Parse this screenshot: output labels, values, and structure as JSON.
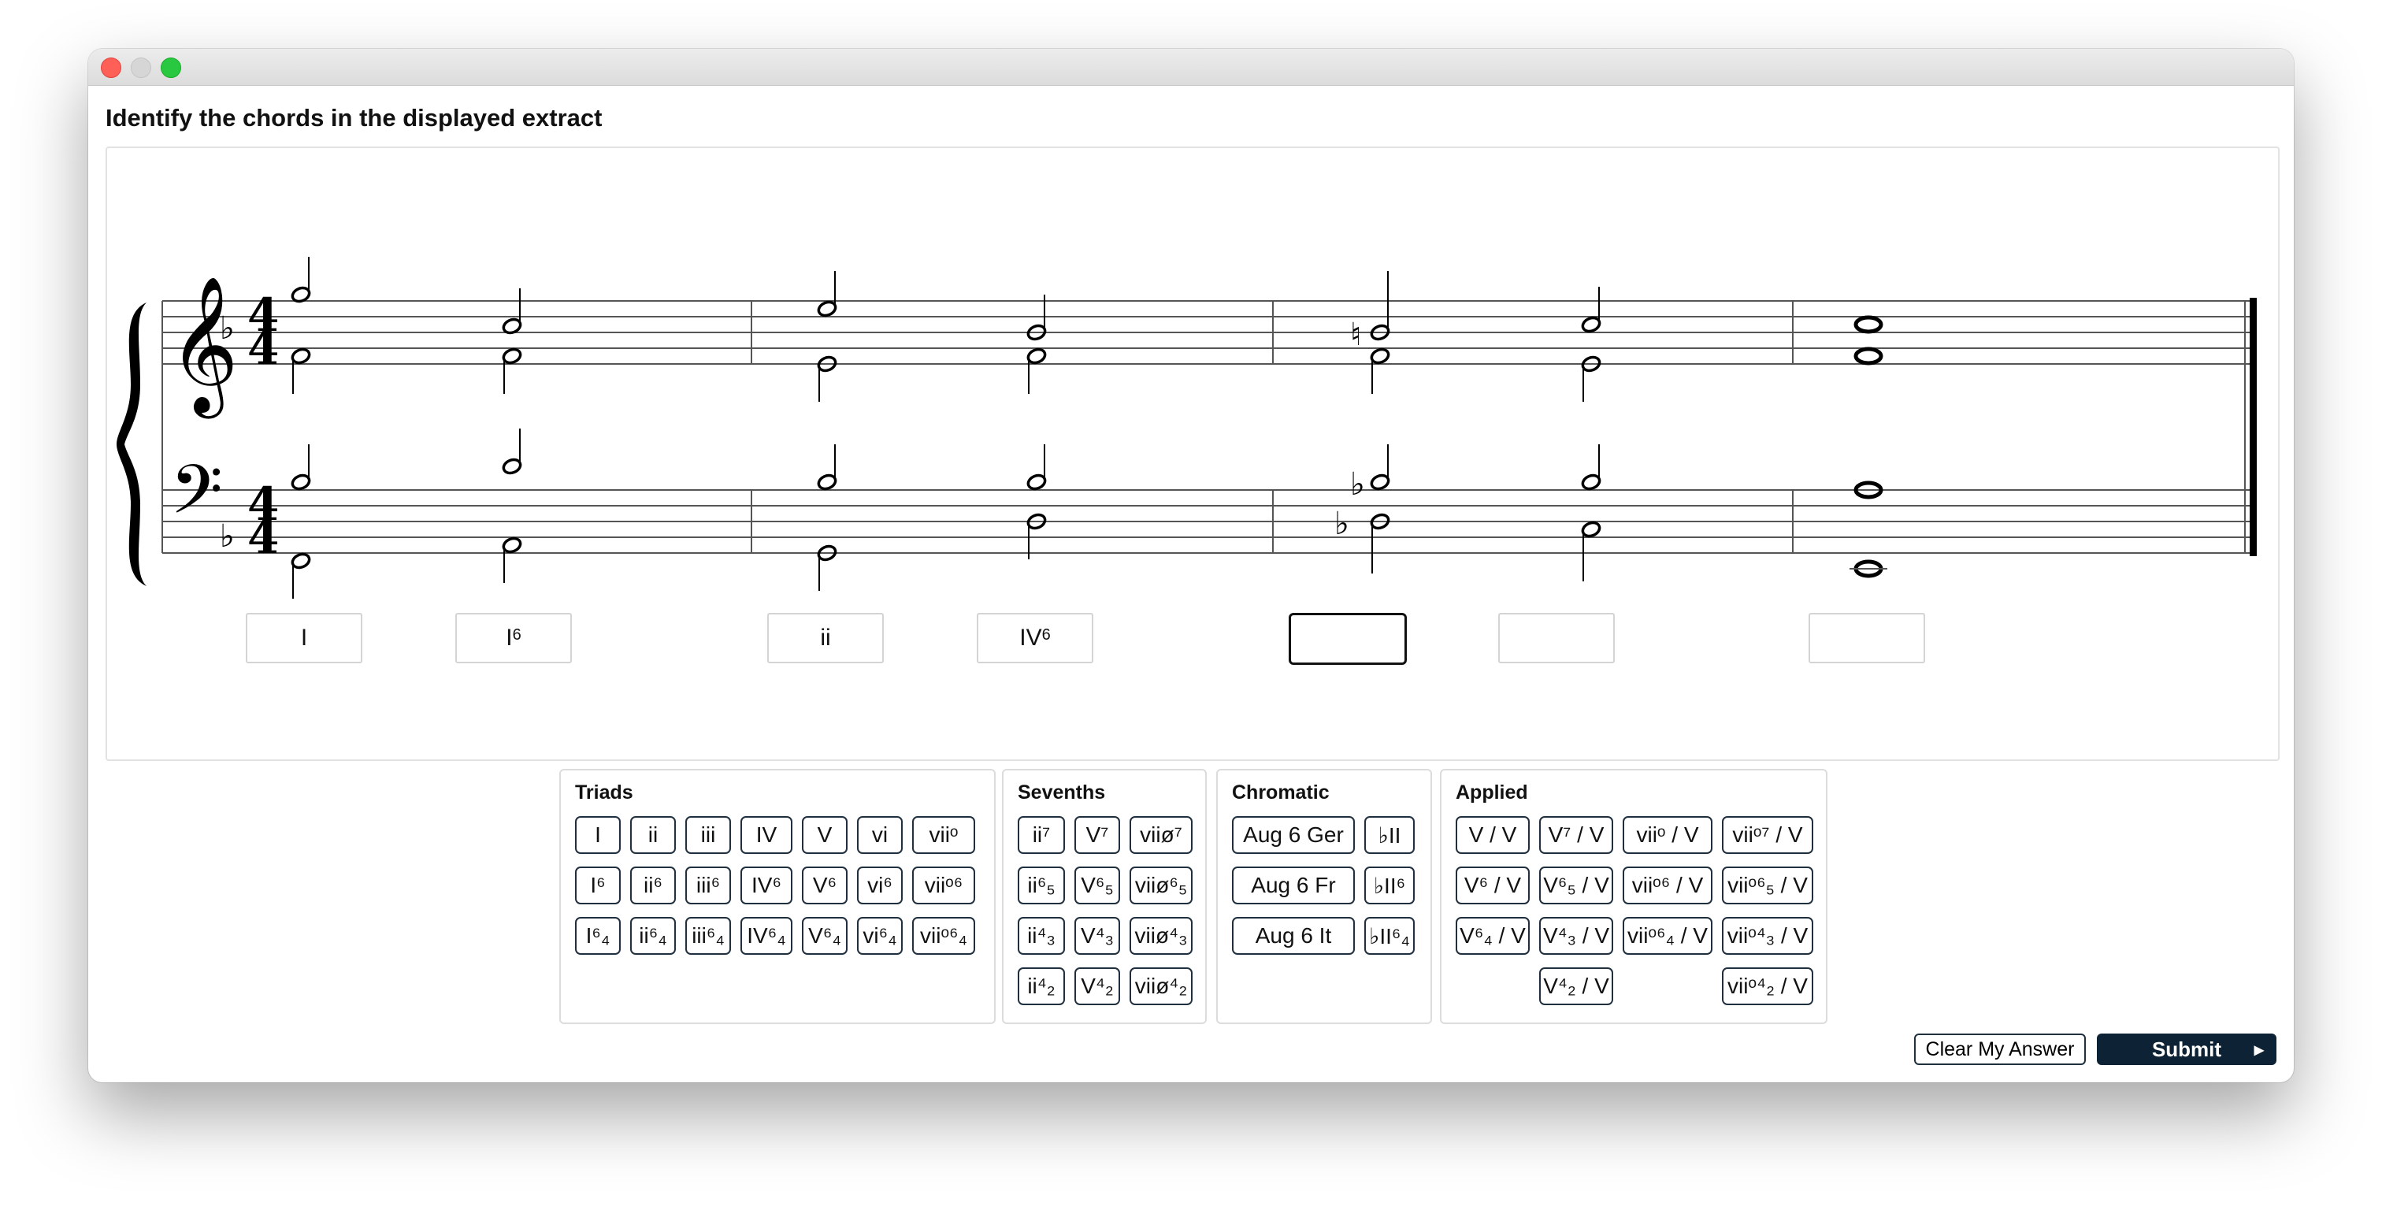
{
  "prompt": "Identify the chords in the displayed extract",
  "answers": [
    {
      "base": "I",
      "sup": ""
    },
    {
      "base": "I",
      "sup": "6"
    },
    {
      "base": "ii",
      "sup": ""
    },
    {
      "base": "IV",
      "sup": "6"
    },
    {
      "base": "",
      "sup": ""
    },
    {
      "base": "",
      "sup": ""
    },
    {
      "base": "",
      "sup": ""
    }
  ],
  "panels": {
    "triads": {
      "title": "Triads",
      "rows": [
        [
          "I",
          "ii",
          "iii",
          "IV",
          "V",
          "vi",
          "viiᵒ"
        ],
        [
          "I⁶",
          "ii⁶",
          "iii⁶",
          "IV⁶",
          "V⁶",
          "vi⁶",
          "viiᵒ⁶"
        ],
        [
          "I⁶₄",
          "ii⁶₄",
          "iii⁶₄",
          "IV⁶₄",
          "V⁶₄",
          "vi⁶₄",
          "viiᵒ⁶₄"
        ]
      ]
    },
    "sevenths": {
      "title": "Sevenths",
      "rows": [
        [
          "ii⁷",
          "V⁷",
          "viiø⁷"
        ],
        [
          "ii⁶₅",
          "V⁶₅",
          "viiø⁶₅"
        ],
        [
          "ii⁴₃",
          "V⁴₃",
          "viiø⁴₃"
        ],
        [
          "ii⁴₂",
          "V⁴₂",
          "viiø⁴₂"
        ]
      ]
    },
    "chromatic": {
      "title": "Chromatic",
      "rows": [
        [
          "Aug 6 Ger",
          "♭II"
        ],
        [
          "Aug 6 Fr",
          "♭II⁶"
        ],
        [
          "Aug 6 It",
          "♭II⁶₄"
        ]
      ]
    },
    "applied": {
      "title": "Applied",
      "rows": [
        [
          "V / V",
          "V⁷ / V",
          "viiᵒ / V",
          "viiᵒ⁷ / V"
        ],
        [
          "V⁶ / V",
          "V⁶₅ / V",
          "viiᵒ⁶ / V",
          "viiᵒ⁶₅ / V"
        ],
        [
          "V⁶₄ / V",
          "V⁴₃ / V",
          "viiᵒ⁶₄ / V",
          "viiᵒ⁴₃ / V"
        ],
        [
          "",
          "V⁴₂ / V",
          "",
          "viiᵒ⁴₂ / V"
        ]
      ]
    }
  },
  "actions": {
    "clear": "Clear My Answer",
    "submit": "Submit"
  },
  "score": {
    "key_signature": "F major (one flat)",
    "time_signature": "4/4",
    "clefs": [
      "treble",
      "bass"
    ]
  }
}
